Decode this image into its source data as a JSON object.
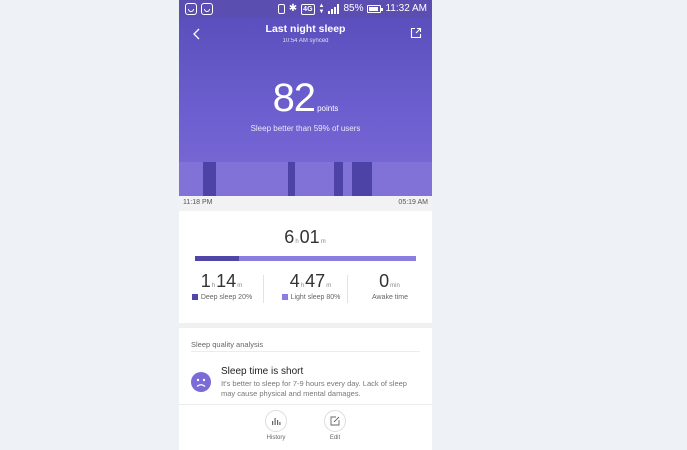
{
  "status_bar": {
    "network": "4G",
    "battery": "85%",
    "time": "11:32 AM"
  },
  "header": {
    "title": "Last night sleep",
    "synced": "10:54 AM synced",
    "back_icon": "back-arrow-icon",
    "share_icon": "share-icon"
  },
  "score": {
    "value": "82",
    "unit": "points",
    "comparison": "Sleep better than 59% of users"
  },
  "sleep_chart": {
    "start_time": "11:18 PM",
    "end_time": "05:19 AM"
  },
  "summary": {
    "total_hours": "6",
    "total_minutes": "01",
    "hour_unit": "h",
    "minute_unit": "m",
    "deep_fraction": 0.2,
    "deep": {
      "hours": "1",
      "minutes": "14",
      "label": "Deep sleep 20%",
      "color": "#4f46a8"
    },
    "light": {
      "hours": "4",
      "minutes": "47",
      "label": "Light sleep 80%",
      "color": "#8a7fe0"
    },
    "awake": {
      "minutes": "0",
      "unit": "min",
      "label": "Awake time"
    }
  },
  "analysis": {
    "section_title": "Sleep quality analysis",
    "tip_title": "Sleep time is short",
    "tip_body": "It's better to sleep for 7-9 hours every day. Lack of sleep may cause physical and mental damages.",
    "tip_icon": "sad-face-icon"
  },
  "bottom_nav": {
    "history_label": "History",
    "edit_label": "Edit"
  },
  "colors": {
    "accent": "#6d5fcf",
    "deep": "#4f46a8",
    "light": "#8a7fe0"
  }
}
